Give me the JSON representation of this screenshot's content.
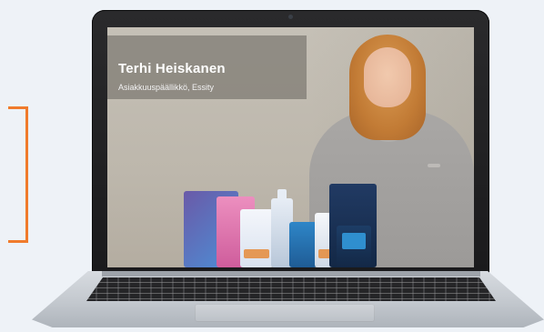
{
  "video": {
    "speaker_name": "Terhi Heiskanen",
    "speaker_title": "Asiakkuuspäällikkö, Essity"
  },
  "colors": {
    "accent_bracket": "#f07b2c"
  }
}
